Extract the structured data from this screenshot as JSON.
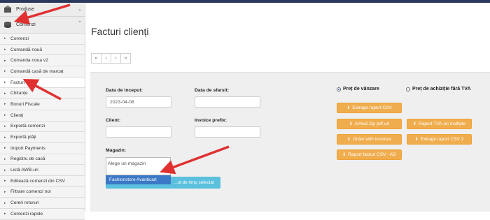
{
  "sidebar": {
    "sections": [
      {
        "label": "Produse",
        "icon": "box-icon"
      },
      {
        "label": "Comenzi",
        "icon": "coins-icon"
      }
    ],
    "items": [
      {
        "label": "Comenzi"
      },
      {
        "label": "Comandă nouă"
      },
      {
        "label": "Comanda noua v2"
      },
      {
        "label": "Comandă casă de marcat"
      },
      {
        "label": "Facturi"
      },
      {
        "label": "Chitanțe"
      },
      {
        "label": "Bonuri Fiscale"
      },
      {
        "label": "Clienți"
      },
      {
        "label": "Exportă comenzi"
      },
      {
        "label": "Exportă plăți"
      },
      {
        "label": "Import Payments"
      },
      {
        "label": "Registru de casă"
      },
      {
        "label": "Listă AWB-uri"
      },
      {
        "label": "Editează comenzi din CSV"
      },
      {
        "label": "Filtrare comenzi noi"
      },
      {
        "label": "Cereri retururi"
      },
      {
        "label": "Comenzi rapide"
      }
    ]
  },
  "main": {
    "title": "Facturi clienți",
    "pager": [
      "«",
      "‹",
      "›",
      "»"
    ],
    "form": {
      "start_date_label": "Data de inceput:",
      "start_date_value": "2023-04-08",
      "end_date_label": "Data de sfarsit:",
      "end_date_value": "",
      "client_label": "Client:",
      "client_value": "",
      "invoice_prefix_label": "Invoice prefix:",
      "invoice_prefix_value": "",
      "store_label": "Magazin:",
      "store_placeholder": "Alege un magazin",
      "store_option": "Fashionstore Avanticart",
      "submit_label": "…ul de timp selectat"
    },
    "price_options": [
      {
        "label": "Preț de vânzare",
        "selected": true
      },
      {
        "label": "Preț de achiziție fără TVA",
        "selected": false
      }
    ],
    "actions": [
      {
        "label": "Extrage raport CSV"
      },
      {
        "label": "Arhivă Zip pdf-uri"
      },
      {
        "label": "Raport TVA-uri multiple"
      },
      {
        "label": "Order with invoices"
      },
      {
        "label": "Extrage raport CSV 2"
      },
      {
        "label": "Raport facturi CSV - AD"
      }
    ]
  },
  "colors": {
    "accent": "#f0ad4e",
    "info": "#5bc0de",
    "selected_option": "#3b78c6",
    "annotation_arrow": "#e03030"
  }
}
